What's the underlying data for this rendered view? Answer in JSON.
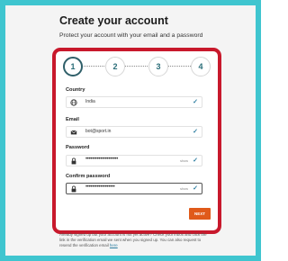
{
  "page": {
    "title": "Create your account",
    "subtitle": "Protect your account with your email and a password"
  },
  "stepper": {
    "steps": [
      "1",
      "2",
      "3",
      "4"
    ],
    "active_step": 1
  },
  "form": {
    "country": {
      "label": "Country",
      "value": "India",
      "icon": "globe-icon"
    },
    "email": {
      "label": "Email",
      "value": "bot@sport.in",
      "icon": "envelope-icon"
    },
    "password": {
      "label": "Password",
      "value": "••••••••••••••••••••",
      "show_label": "show",
      "icon": "lock-icon"
    },
    "confirm_password": {
      "label": "Confirm password",
      "value": "••••••••••••••••••",
      "show_label": "show",
      "icon": "lock-icon"
    },
    "next_label": "NEXT"
  },
  "footer": {
    "note": "Already signed up but your account is not yet active? Check your inbox and click the link in the verification email we sent when you signed up. You can also request to resend the verification email",
    "link_text": "here"
  },
  "colors": {
    "frame": "#3fc5cf",
    "card_border": "#c8192c",
    "button": "#e05a1a",
    "check": "#2c7da0"
  }
}
